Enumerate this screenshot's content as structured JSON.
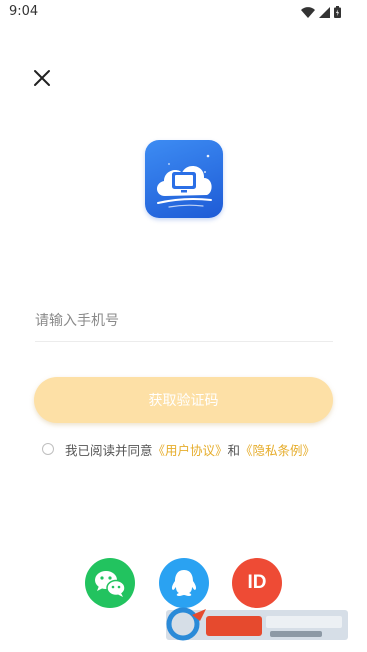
{
  "status_bar": {
    "time": "9:04",
    "icons": [
      "wifi-icon",
      "cellular-signal-icon",
      "battery-icon"
    ]
  },
  "header": {
    "close_icon": "close-icon"
  },
  "logo": {
    "icon": "cloud-computer-icon"
  },
  "login_form": {
    "phone_placeholder": "请输入手机号",
    "phone_value": "",
    "get_code_label": "获取验证码"
  },
  "agreement": {
    "prefix": "我已阅读并同意",
    "user_agreement": "《用户协议》",
    "conjunction": "和",
    "privacy_policy": "《隐私条例》",
    "checked": false
  },
  "social_login": {
    "items": [
      {
        "icon": "wechat-icon",
        "color": "#22c35f"
      },
      {
        "icon": "qq-icon",
        "color": "#2aa2f2"
      },
      {
        "icon": "id-login-icon",
        "label": "ID",
        "color": "#ee4b35"
      }
    ]
  },
  "colors": {
    "button_bg": "#fde0a6",
    "link": "#e6ad2c",
    "logo_bg": "#2b6fe6"
  }
}
